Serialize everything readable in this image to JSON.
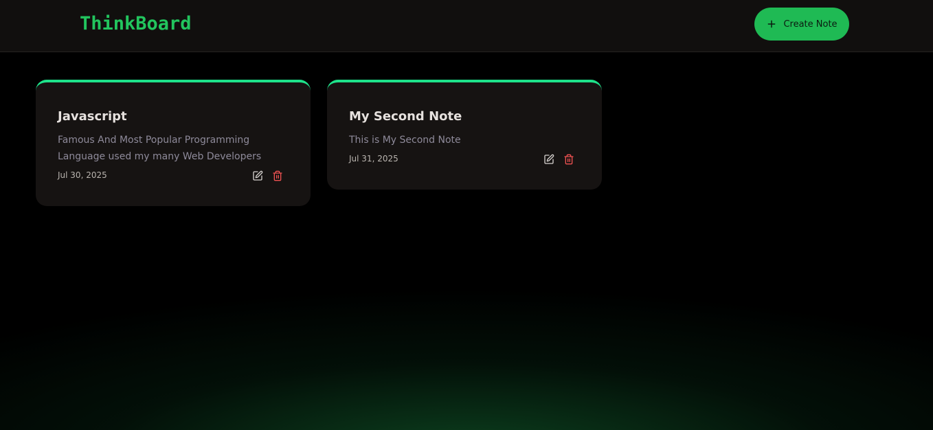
{
  "header": {
    "brand": "ThinkBoard",
    "create_button": {
      "label": "Create Note",
      "icon": "plus-icon"
    }
  },
  "colors": {
    "accent": "#22c55e",
    "button_bg": "#1fba54",
    "card_top_border": "#1ee28a",
    "card_bg": "#161312",
    "delete_icon": "#f05252"
  },
  "notes": [
    {
      "title": "Javascript",
      "content": "Famous And Most Popular Programming Language used my many Web Developers",
      "date": "Jul 30, 2025",
      "edit_icon": "pen-square-icon",
      "delete_icon": "trash-icon"
    },
    {
      "title": "My Second Note",
      "content": "This is My Second Note",
      "date": "Jul 31, 2025",
      "edit_icon": "pen-square-icon",
      "delete_icon": "trash-icon"
    }
  ]
}
